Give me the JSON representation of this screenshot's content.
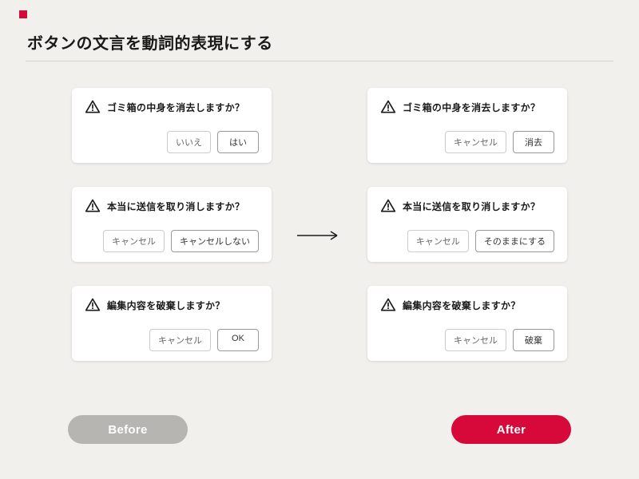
{
  "title": "ボタンの文言を動詞的表現にする",
  "before": {
    "label": "Before",
    "cards": [
      {
        "title": "ゴミ箱の中身を消去しますか？",
        "cancel": "いいえ",
        "confirm": "はい"
      },
      {
        "title": "本当に送信を取り消しますか？",
        "cancel": "キャンセル",
        "confirm": "キャンセルしない"
      },
      {
        "title": "編集内容を破棄しますか？",
        "cancel": "キャンセル",
        "confirm": "OK"
      }
    ]
  },
  "after": {
    "label": "After",
    "cards": [
      {
        "title": "ゴミ箱の中身を消去しますか？",
        "cancel": "キャンセル",
        "confirm": "消去"
      },
      {
        "title": "本当に送信を取り消しますか？",
        "cancel": "キャンセル",
        "confirm": "そのままにする"
      },
      {
        "title": "編集内容を破棄しますか？",
        "cancel": "キャンセル",
        "confirm": "破棄"
      }
    ]
  }
}
